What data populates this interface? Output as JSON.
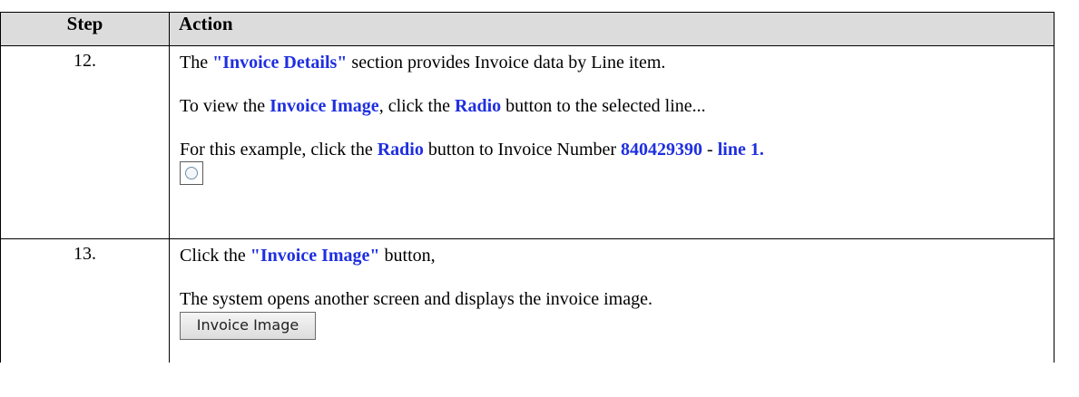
{
  "table": {
    "headers": {
      "step": "Step",
      "action": "Action"
    },
    "rows": [
      {
        "step": "12.",
        "p1": {
          "t1": "The ",
          "e1": "\"Invoice Details\"",
          "t2": " section provides Invoice data by Line item."
        },
        "p2": {
          "t1": "To view the ",
          "e1": "Invoice Image",
          "t2": ", click the ",
          "e2": "Radio",
          "t3": " button to the selected line..."
        },
        "p3": {
          "t1": "For this example, click the ",
          "e1": "Radio",
          "t2": " button to Invoice Number ",
          "e2": "840429390",
          "t3": " - ",
          "e3": "line 1."
        },
        "radio_icon": "radio-button-icon"
      },
      {
        "step": "13.",
        "p1": {
          "t1": "Click the ",
          "e1": "\"Invoice Image\"",
          "t2": " button,"
        },
        "p2": {
          "t1": "The system opens another screen and displays the invoice image."
        },
        "button_label": "Invoice Image"
      }
    ]
  },
  "colors": {
    "emphasis": "#1f2fe0",
    "header_bg": "#dcdcdc"
  }
}
